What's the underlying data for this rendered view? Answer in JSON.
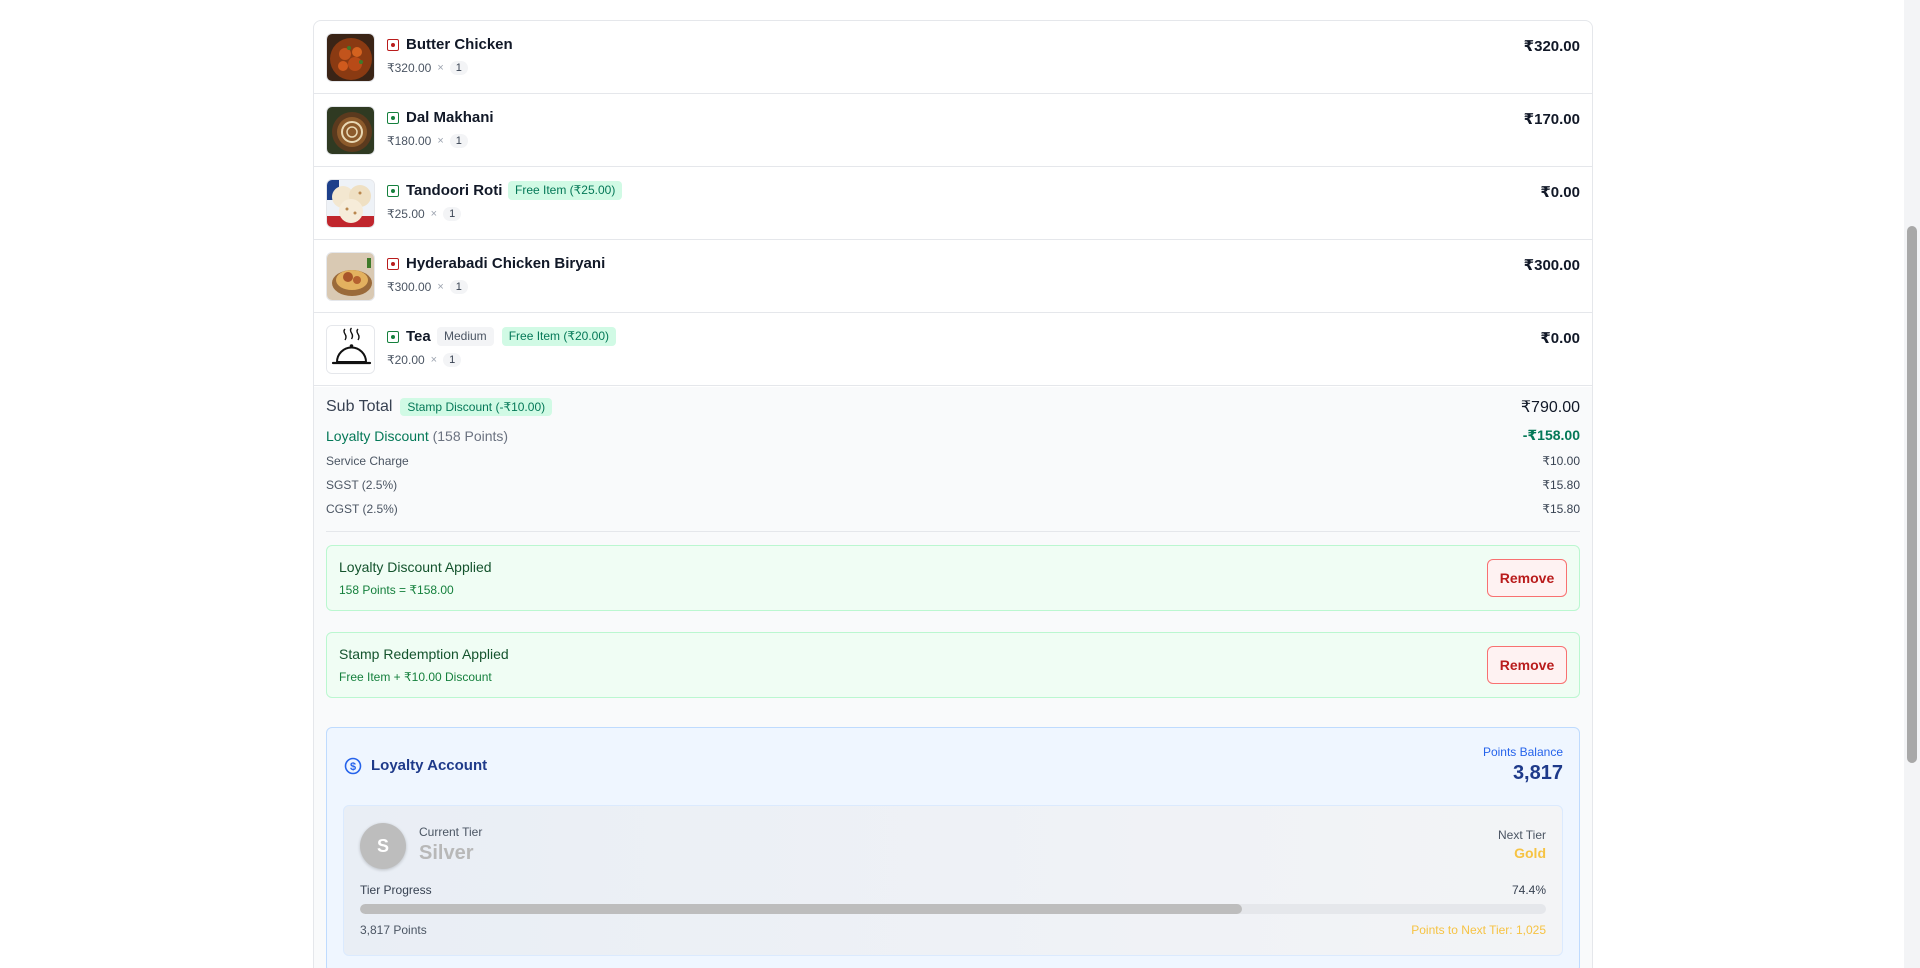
{
  "order": {
    "items": [
      {
        "name": "Butter Chicken",
        "type": "nonveg",
        "unit_price": "₹320.00",
        "times": "×",
        "qty": "1",
        "total": "₹320.00",
        "tags": [],
        "image_icon": "butter-chicken-image"
      },
      {
        "name": "Dal Makhani",
        "type": "veg",
        "unit_price": "₹180.00",
        "times": "×",
        "qty": "1",
        "total": "₹170.00",
        "tags": [],
        "image_icon": "dal-makhani-image"
      },
      {
        "name": "Tandoori Roti",
        "type": "veg",
        "unit_price": "₹25.00",
        "times": "×",
        "qty": "1",
        "total": "₹0.00",
        "tags": [
          {
            "text": "Free Item (₹25.00)",
            "kind": "free"
          }
        ],
        "image_icon": "tandoori-roti-image"
      },
      {
        "name": "Hyderabadi Chicken Biryani",
        "type": "nonveg",
        "unit_price": "₹300.00",
        "times": "×",
        "qty": "1",
        "total": "₹300.00",
        "tags": [],
        "image_icon": "biryani-image"
      },
      {
        "name": "Tea",
        "type": "veg",
        "unit_price": "₹20.00",
        "times": "×",
        "qty": "1",
        "total": "₹0.00",
        "tags": [
          {
            "text": "Medium",
            "kind": "variant"
          },
          {
            "text": "Free Item (₹20.00)",
            "kind": "free"
          }
        ],
        "image_icon": "cloche-placeholder-icon"
      }
    ]
  },
  "summary": {
    "subtotal_label": "Sub Total",
    "stamp_discount_tag": "Stamp Discount (-₹10.00)",
    "subtotal_value": "₹790.00",
    "loyalty_label": "Loyalty Discount",
    "loyalty_points": "(158 Points)",
    "loyalty_value": "-₹158.00",
    "service_label": "Service Charge",
    "service_value": "₹10.00",
    "sgst_label": "SGST (2.5%)",
    "sgst_value": "₹15.80",
    "cgst_label": "CGST (2.5%)",
    "cgst_value": "₹15.80"
  },
  "loyalty_applied": {
    "title": "Loyalty Discount Applied",
    "subtitle": "158 Points = ₹158.00",
    "remove_label": "Remove"
  },
  "stamp_applied": {
    "title": "Stamp Redemption Applied",
    "subtitle": "Free Item + ₹10.00 Discount",
    "remove_label": "Remove"
  },
  "loyalty_account": {
    "title": "Loyalty Account",
    "icon": "dollar-circle-icon",
    "points_balance_label": "Points Balance",
    "points_balance_value": "3,817",
    "tier": {
      "avatar_letter": "S",
      "current_label": "Current Tier",
      "current_value": "Silver",
      "next_label": "Next Tier",
      "next_value": "Gold",
      "progress_label": "Tier Progress",
      "progress_text": "74.4%",
      "progress_value": 74.4,
      "points_text": "3,817 Points",
      "to_next_text": "Points to Next Tier: 1,025"
    }
  },
  "colors": {
    "free_tag_bg": "#d1fae5",
    "free_tag_text": "#047857",
    "silver": "#bdbdbd",
    "gold": "#f6c343",
    "remove_red": "#b91c1c"
  }
}
